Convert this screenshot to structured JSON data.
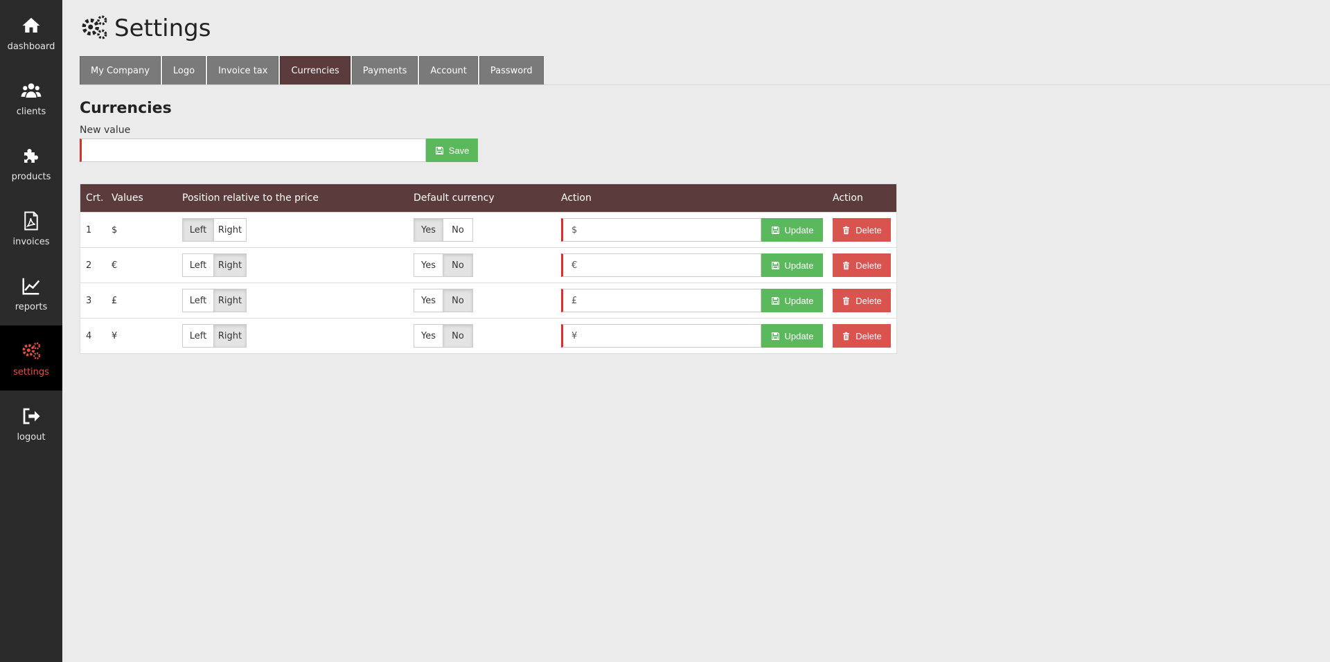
{
  "sidebar": {
    "items": [
      {
        "label": "dashboard",
        "icon": "home-icon"
      },
      {
        "label": "clients",
        "icon": "users-icon"
      },
      {
        "label": "products",
        "icon": "puzzle-icon"
      },
      {
        "label": "invoices",
        "icon": "pdf-file-icon"
      },
      {
        "label": "reports",
        "icon": "line-chart-icon"
      },
      {
        "label": "settings",
        "icon": "gears-icon",
        "active": true
      },
      {
        "label": "logout",
        "icon": "sign-out-icon"
      }
    ]
  },
  "page": {
    "title": "Settings"
  },
  "tabs": [
    {
      "label": "My Company"
    },
    {
      "label": "Logo"
    },
    {
      "label": "Invoice tax"
    },
    {
      "label": "Currencies",
      "active": true
    },
    {
      "label": "Payments"
    },
    {
      "label": "Account"
    },
    {
      "label": "Password"
    }
  ],
  "currencies": {
    "section_title": "Currencies",
    "new_value_label": "New value",
    "new_value": "",
    "save_label": "Save"
  },
  "table": {
    "headers": [
      "Crt.",
      "Values",
      "Position relative to the price",
      "Default currency",
      "Action",
      "Action"
    ],
    "position_options": [
      "Left",
      "Right"
    ],
    "default_options": [
      "Yes",
      "No"
    ],
    "update_label": "Update",
    "delete_label": "Delete",
    "rows": [
      {
        "crt": "1",
        "value": "$",
        "position": "Left",
        "default": "Yes",
        "input": "$"
      },
      {
        "crt": "2",
        "value": "€",
        "position": "Right",
        "default": "No",
        "input": "€"
      },
      {
        "crt": "3",
        "value": "£",
        "position": "Right",
        "default": "No",
        "input": "£"
      },
      {
        "crt": "4",
        "value": "¥",
        "position": "Right",
        "default": "No",
        "input": "¥"
      }
    ]
  },
  "colors": {
    "sidebar_bg": "#2b2b2b",
    "active_accent": "#e8523b",
    "header_bg": "#5b3b3b",
    "success": "#5cb85c",
    "danger": "#d9534f",
    "required_border": "#d9302b"
  }
}
